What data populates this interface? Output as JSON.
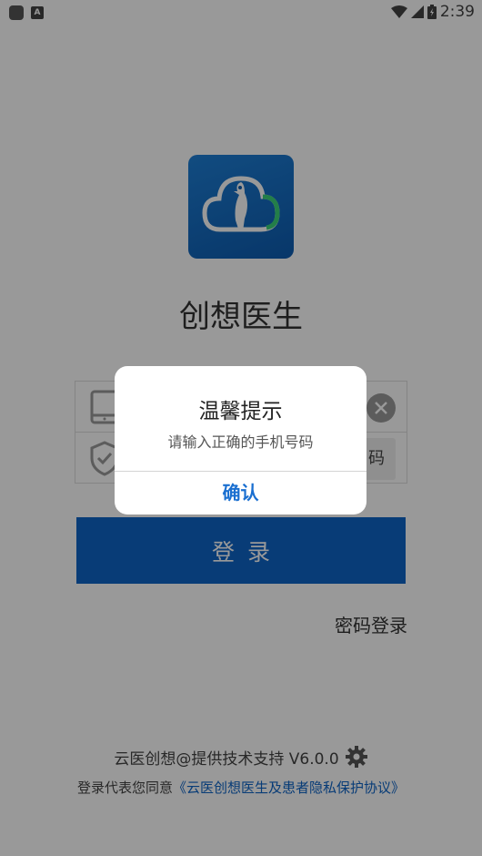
{
  "status_bar": {
    "time": "2:39"
  },
  "app": {
    "name": "创想医生"
  },
  "form": {
    "phone_placeholder": "",
    "code_placeholder": "",
    "get_code_label": "码"
  },
  "actions": {
    "login_label": "登录",
    "password_login_label": "密码登录"
  },
  "footer": {
    "support_text": "云医创想@提供技术支持 V6.0.0",
    "agreement_prefix": "登录代表您同意",
    "agreement_link": "《云医创想医生及患者隐私保护协议》"
  },
  "dialog": {
    "title": "温馨提示",
    "message": "请输入正确的手机号码",
    "confirm_label": "确认"
  },
  "colors": {
    "primary": "#0e64c6",
    "overlay": "rgba(0,0,0,0.4)"
  }
}
